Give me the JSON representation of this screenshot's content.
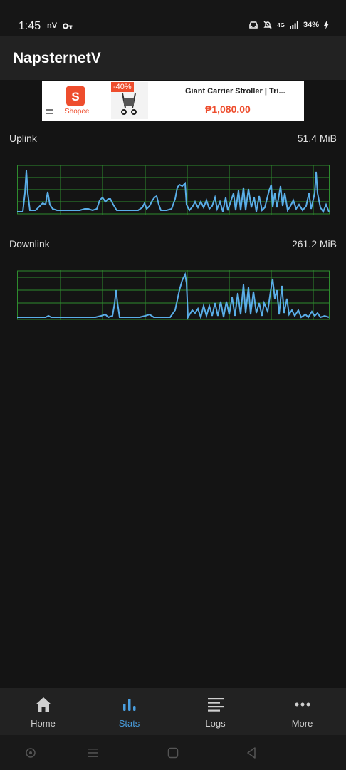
{
  "status_bar": {
    "time": "1:45",
    "left_icons": [
      "nV",
      "key-icon"
    ],
    "battery": "34%",
    "network": "4G"
  },
  "app": {
    "title": "NapsternetV"
  },
  "ad": {
    "brand": "Shopee",
    "discount": "-40%",
    "product_title": "Giant Carrier Stroller | Tri...",
    "price": "₱1,080.00"
  },
  "uplink": {
    "label": "Uplink",
    "total": "51.4 MiB"
  },
  "downlink": {
    "label": "Downlink",
    "total": "261.2 MiB"
  },
  "nav": [
    {
      "label": "Home",
      "icon": "home-icon"
    },
    {
      "label": "Stats",
      "icon": "bar-chart-icon"
    },
    {
      "label": "Logs",
      "icon": "list-icon"
    },
    {
      "label": "More",
      "icon": "more-dots-icon"
    }
  ],
  "nav_active": "Stats",
  "colors": {
    "accent": "#4a9fe0",
    "grid": "#2e8b2e",
    "trace": "#5aaee8"
  }
}
